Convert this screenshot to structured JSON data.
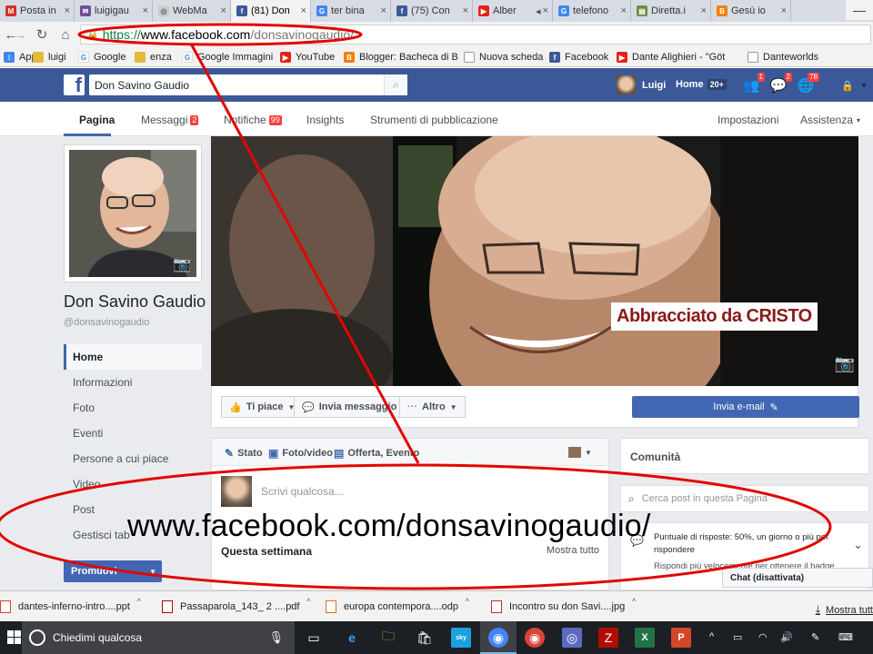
{
  "browser": {
    "tabs": [
      {
        "label": "Posta in",
        "icon": "gmail-icon",
        "color": "#d93025",
        "active": false
      },
      {
        "label": "luigigau",
        "icon": "mail-icon",
        "color": "#6b4e9b",
        "active": false
      },
      {
        "label": "WebMa",
        "icon": "webmail-icon",
        "color": "#cccccc",
        "active": false
      },
      {
        "label": "(81) Don",
        "icon": "facebook-icon",
        "color": "#3b5998",
        "active": true
      },
      {
        "label": "ter bina",
        "icon": "google-icon",
        "color": "#4285f4",
        "active": false
      },
      {
        "label": "(75) Con",
        "icon": "facebook-icon",
        "color": "#3b5998",
        "active": false
      },
      {
        "label": "Alber",
        "icon": "youtube-icon",
        "color": "#e62117",
        "active": false
      },
      {
        "label": "telefono",
        "icon": "google-icon",
        "color": "#4285f4",
        "active": false
      },
      {
        "label": "Diretta.i",
        "icon": "page-icon",
        "color": "#6c8e3e",
        "active": false
      },
      {
        "label": "Gesù io",
        "icon": "blogger-icon",
        "color": "#f57d00",
        "active": false
      }
    ],
    "address": {
      "scheme": "https://",
      "host": "www.facebook.com",
      "path": "/donsavinogaudio/"
    },
    "bookmarks": [
      {
        "label": "App",
        "icon": "apps-icon"
      },
      {
        "label": "luigi",
        "icon": "folder-icon"
      },
      {
        "label": "Google",
        "icon": "google-icon"
      },
      {
        "label": "enza",
        "icon": "folder-icon"
      },
      {
        "label": "Google Immagini",
        "icon": "google-icon"
      },
      {
        "label": "YouTube",
        "icon": "youtube-icon"
      },
      {
        "label": "Blogger: Bacheca di B",
        "icon": "blogger-icon"
      },
      {
        "label": "Nuova scheda",
        "icon": "page-icon"
      },
      {
        "label": "Facebook",
        "icon": "facebook-icon"
      },
      {
        "label": "Dante Alighieri - \"Göt",
        "icon": "youtube-icon"
      },
      {
        "label": "Danteworlds",
        "icon": "page-icon"
      }
    ]
  },
  "facebook": {
    "search_value": "Don Savino Gaudio",
    "user_name": "Luigi",
    "home_label": "Home",
    "home_badge": "20+",
    "notif_friends": "1",
    "notif_messages": "2",
    "notif_general": "78",
    "page_nav": {
      "pagina": "Pagina",
      "messaggi": "Messaggi",
      "messaggi_count": "2",
      "notifiche": "Notifiche",
      "notifiche_count": "99",
      "insights": "Insights",
      "strumenti": "Strumenti di pubblicazione",
      "impostazioni": "Impostazioni",
      "assistenza": "Assistenza"
    },
    "page_name": "Don Savino Gaudio",
    "page_handle": "@donsavinogaudio",
    "side_nav": [
      "Home",
      "Informazioni",
      "Foto",
      "Eventi",
      "Persone a cui piace",
      "Video",
      "Post",
      "Gestisci tab"
    ],
    "promote_label": "Promuovi",
    "cover_badge": {
      "text": "Abbracciato da",
      "bold": "CRISTO"
    },
    "actions": {
      "like": "Ti piace",
      "message": "Invia messaggio",
      "more": "Altro",
      "email": "Invia e-mail"
    },
    "composer": {
      "stato": "Stato",
      "foto": "Foto/video",
      "offerta": "Offerta, Evento",
      "placeholder": "Scrivi qualcosa...",
      "week": "Questa settimana",
      "show_all": "Mostra tutto"
    },
    "right": {
      "community": "Comunità",
      "search_placeholder": "Cerca post in questa Pagina",
      "response_line": "Puntuale di risposte: 50%, un giorno o più per rispondere",
      "respond_faster": "Rispondi più velocemente per ottenere il badge",
      "chat": "Chat (disattivata)"
    }
  },
  "downloads": {
    "items": [
      {
        "label": "dantes-inferno-intro....ppt",
        "color": "#d24726"
      },
      {
        "label": "Passaparola_143_ 2 ....pdf",
        "color": "#b30b00"
      },
      {
        "label": "europa contempora....odp",
        "color": "#e16d1b"
      },
      {
        "label": "Incontro su don Savi....jpg",
        "color": "#c62828"
      }
    ],
    "show_all": "Mostra tutt"
  },
  "taskbar": {
    "search_placeholder": "Chiedimi qualcosa"
  },
  "annotation": {
    "text": "www.facebook.com/donsavinogaudio/",
    "color": "#e10600"
  }
}
